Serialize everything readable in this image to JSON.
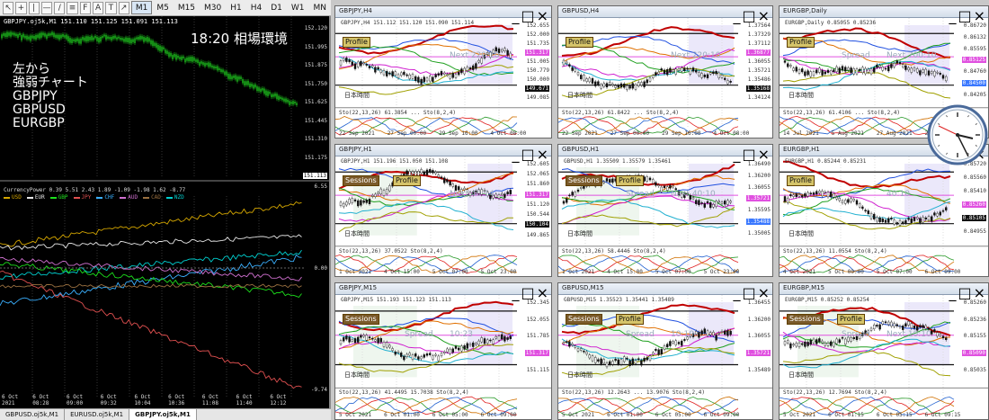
{
  "toolbar": {
    "icons": [
      "cursor-icon",
      "crosshair-icon",
      "vline-icon",
      "hline-icon",
      "trend-icon",
      "channel-icon",
      "fib-icon",
      "text-icon",
      "label-icon",
      "arrow-icon"
    ],
    "icon_glyphs": [
      "↖",
      "+",
      "|",
      "—",
      "/",
      "≡",
      "F",
      "A",
      "T",
      "↗"
    ],
    "timeframes": [
      "M1",
      "M5",
      "M15",
      "M30",
      "H1",
      "H4",
      "D1",
      "W1",
      "MN"
    ],
    "active_timeframe": "M1"
  },
  "big_chart": {
    "title": "GBPJPY.oj5k,M1  151.110 151.125 151.091 151.113",
    "clock_text": "18:20  相場環境",
    "note_lines": [
      "左から",
      "強弱チャート",
      "GBPJPY",
      "GBPUSD",
      "EURGBP"
    ],
    "price_levels": [
      "152.120",
      "151.995",
      "151.875",
      "151.750",
      "151.625",
      "151.445",
      "151.310",
      "151.175",
      "151.113"
    ],
    "indicator_title": "CurrencyPower 0.39 5.51 2.43 1.89 -1.09 -1.98 1.62 -8.77",
    "indicator_scale_top": "6.55",
    "indicator_scale_mid": "0.00",
    "indicator_scale_bottom": "-9.74",
    "legend": [
      {
        "name": "USD",
        "color": "#d4a600"
      },
      {
        "name": "EUR",
        "color": "#e8e8e8"
      },
      {
        "name": "GBP",
        "color": "#1ce01c"
      },
      {
        "name": "JPY",
        "color": "#e05050"
      },
      {
        "name": "CHF",
        "color": "#3ab0ff"
      },
      {
        "name": "AUD",
        "color": "#d070d0"
      },
      {
        "name": "CAD",
        "color": "#9a7040"
      },
      {
        "name": "NZD",
        "color": "#00d0d0"
      }
    ],
    "time_axis": [
      "6 Oct 2021",
      "6 Oct 08:28",
      "6 Oct 09:00",
      "6 Oct 09:32",
      "6 Oct 10:04",
      "6 Oct 10:36",
      "6 Oct 11:08",
      "6 Oct 11:40",
      "6 Oct 12:12"
    ]
  },
  "tabs": [
    {
      "label": "GBPUSD.oj5k,M1",
      "active": false
    },
    {
      "label": "EURUSD.oj5k,M1",
      "active": false
    },
    {
      "label": "GBPJPY.oj5k,M1",
      "active": true
    }
  ],
  "mini_charts": [
    {
      "id": "gbpjpy-h4",
      "title": "GBPJPY,H4",
      "header": "GBPJPY,H4  151.112 151.120 151.090 151.114",
      "badges": [
        "Profile"
      ],
      "jp": "日本時間",
      "next": "Next 220:10",
      "spread": "",
      "scale": [
        "152.655",
        "152.000",
        "151.735",
        "151.317",
        "151.005",
        "150.779",
        "150.000",
        "149.671",
        "149.085"
      ],
      "osc": "Sto(22,13,26) 61.3854 ... Sto(8,2,4)",
      "time": [
        "22 Sep 2021",
        "27 Sep 00:00",
        "29 Sep 16:00",
        "4 Oct 08:00"
      ]
    },
    {
      "id": "gbpusd-h4",
      "title": "GBPUSD,H4",
      "header": "",
      "badges": [
        "Profile"
      ],
      "jp": "日本時間",
      "next": "Next 220:10",
      "spread": "",
      "scale": [
        "1.37564",
        "1.37329",
        "1.37112",
        "1.36877",
        "1.36055",
        "1.35721",
        "1.35486",
        "1.35168",
        "1.34124"
      ],
      "osc": "Sto(22,13,26) 61.8422 ... Sto(8,2,4)",
      "time": [
        "22 Sep 2021",
        "27 Sep 00:00",
        "29 Sep 16:00",
        "4 Oct 08:00"
      ]
    },
    {
      "id": "eurgbp-daily",
      "title": "EURGBP,Daily",
      "header": "EURGBP,Daily  0.85055 0.85236",
      "badges": [
        "Profile"
      ],
      "jp": "日本時間",
      "next": "Next 700:10",
      "spread": "Spread",
      "scale": [
        "0.86720",
        "0.86132",
        "0.85595",
        "0.85125",
        "0.84760",
        "0.84500",
        "0.84205"
      ],
      "osc": "Sto(22,13,26) 61.4106 ... Sto(8,2,4)",
      "time": [
        "14 Jul 2021",
        "5 Aug 2021",
        "27 Aug 2021",
        "20 Sep 2021"
      ]
    },
    {
      "id": "gbpjpy-h1",
      "title": "GBPJPY,H1",
      "header": "GBPJPY,H1  151.196 151.050 151.108",
      "badges": [
        "Sessions",
        "Profile"
      ],
      "jp": "日本時間",
      "next": "Next 40:14",
      "spread": "",
      "scale": [
        "152.605",
        "152.065",
        "151.860",
        "151.317",
        "151.120",
        "150.544",
        "150.104",
        "149.865"
      ],
      "osc": "Sto(22,13,26) 37.0522 Sto(8,2,4)",
      "time": [
        "1 Oct 2021",
        "4 Oct 15:00",
        "5 Oct 07:00",
        "5 Oct 23:00"
      ]
    },
    {
      "id": "gbpusd-h1",
      "title": "GBPUSD,H1",
      "header": "GBPUSD,H1  1.35509 1.35579 1.35461",
      "badges": [
        "Sessions",
        "Profile"
      ],
      "jp": "日本時間",
      "next": "Next 40:10",
      "spread": "Spread",
      "scale": [
        "1.36490",
        "1.36200",
        "1.36055",
        "1.35721",
        "1.35595",
        "1.35488",
        "1.35005"
      ],
      "osc": "Sto(22,13,26) 58.4446 Sto(8,2,4)",
      "time": [
        "1 Oct 2021",
        "4 Oct 15:00",
        "5 Oct 07:00",
        "5 Oct 23:00"
      ]
    },
    {
      "id": "eurgbp-h1",
      "title": "EURGBP,H1",
      "header": "EURGBP,H1  0.85244 0.85231",
      "badges": [
        "Profile"
      ],
      "jp": "日本時間",
      "next": "40:10",
      "spread": "",
      "scale": [
        "0.85720",
        "0.85560",
        "0.85410",
        "0.85260",
        "0.85105",
        "0.84955"
      ],
      "osc": "Sto(22,13,26) 11.0554 Sto(8,2,4)",
      "time": [
        "4 Oct 2021",
        "5 Oct 00:00",
        "5 Oct 07:00",
        "6 Oct 09:00"
      ]
    },
    {
      "id": "gbpjpy-m15",
      "title": "GBPJPY,M15",
      "header": "GBPJPY,M15  151.193 151.123 151.113",
      "badges": [
        "Sessions"
      ],
      "jp": "日本時間",
      "next": "10:23",
      "spread": "Spread",
      "scale": [
        "152.345",
        "152.055",
        "151.785",
        "151.317",
        "151.115"
      ],
      "osc": "Sto(22,13,26) 41.4495 15.7038 Sto(8,2,4)",
      "time": [
        "5 Oct 2021",
        "6 Oct 01:00",
        "6 Oct 05:00",
        "6 Oct 09:00"
      ]
    },
    {
      "id": "gbpusd-m15",
      "title": "GBPUSD,M15",
      "header": "GBPUSD,M15  1.35523 1.35441 1.35489",
      "badges": [
        "Sessions",
        "Profile"
      ],
      "jp": "日本時間",
      "next": "10:10",
      "spread": "Spread",
      "scale": [
        "1.36455",
        "1.36200",
        "1.36055",
        "1.35721",
        "1.35489"
      ],
      "osc": "Sto(22,13,26) 12.2643 ... 13.9076 Sto(8,2,4)",
      "time": [
        "5 Oct 2021",
        "6 Oct 01:00",
        "6 Oct 05:00",
        "6 Oct 09:00"
      ]
    },
    {
      "id": "eurgbp-m15",
      "title": "EURGBP,M15",
      "header": "EURGBP,M15  0.85252 0.85254",
      "badges": [
        "Sessions",
        "Profile"
      ],
      "jp": "日本時間",
      "next": "Next 10:10",
      "spread": "Spread",
      "scale": [
        "0.85260",
        "0.85236",
        "0.85155",
        "0.85090",
        "0.85035"
      ],
      "osc": "Sto(22,13,26) 12.7694 Sto(8,2,4)",
      "time": [
        "5 Oct 2021",
        "6 Oct 01:15",
        "6 Oct 05:15",
        "6 Oct 09:15"
      ]
    }
  ],
  "colors": {
    "candle_up": "#1ec81e",
    "bg_dark": "#000000",
    "resistance": "#e050e0",
    "support": "#3a78ff"
  }
}
